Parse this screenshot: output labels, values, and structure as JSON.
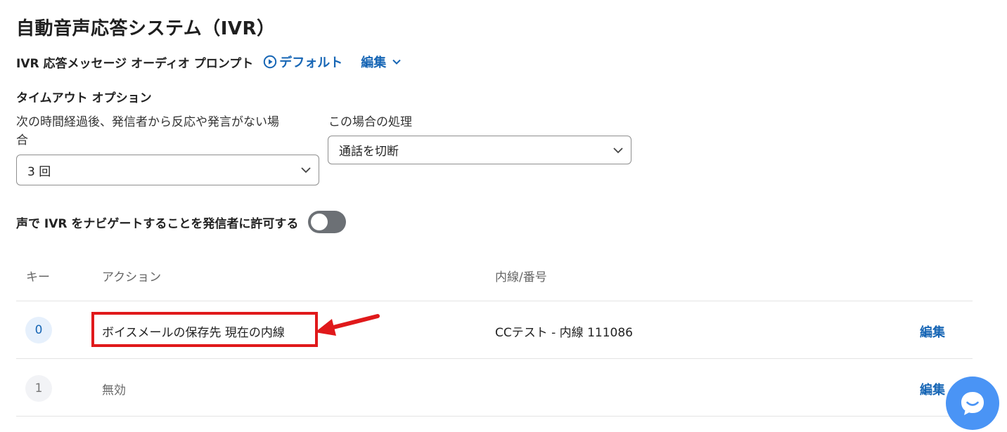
{
  "page": {
    "title": "自動音声応答システム（IVR）"
  },
  "prompt": {
    "label": "IVR 応答メッセージ オーディオ プロンプト",
    "default_link": "デフォルト",
    "edit_link": "編集",
    "play_icon": "play-circle-icon",
    "edit_icon": "chevron-down-icon"
  },
  "timeout": {
    "heading": "タイムアウト オプション",
    "after_label_line1": "次の時間経過後、発信者から反応や発言がない場",
    "after_label_line2": "合",
    "after_value": "3 回",
    "action_label": "この場合の処理",
    "action_value": "通話を切断"
  },
  "voice_nav": {
    "label": "声で IVR をナビゲートすることを発信者に許可する",
    "enabled": false
  },
  "table": {
    "headers": {
      "key": "キー",
      "action": "アクション",
      "extension": "内線/番号"
    },
    "rows": [
      {
        "key": "0",
        "action": "ボイスメールの保存先 現在の内線",
        "extension": "CCテスト - 内線 111086",
        "edit": "編集"
      },
      {
        "key": "1",
        "action": "無効",
        "extension": "",
        "edit": "編集"
      }
    ]
  },
  "colors": {
    "accent": "#1766b5",
    "highlight": "#e0191b",
    "toggle_off": "#6c7075",
    "chat_button": "#4a94f5"
  },
  "chat": {
    "icon": "chat-bubble-icon"
  }
}
